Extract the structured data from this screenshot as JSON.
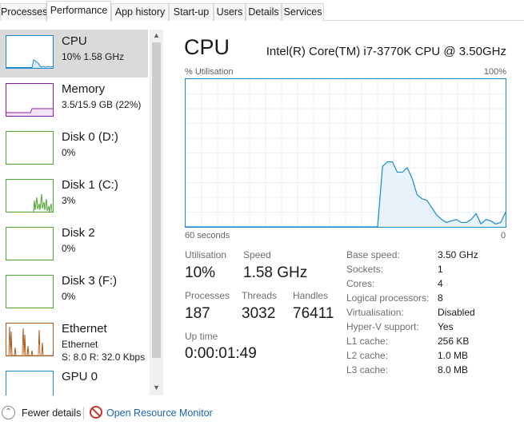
{
  "tabs": [
    "Processes",
    "Performance",
    "App history",
    "Start-up",
    "Users",
    "Details",
    "Services"
  ],
  "sidebar": {
    "items": [
      {
        "name": "CPU",
        "sub": "10% 1.58 GHz",
        "color": "#1a8ad0"
      },
      {
        "name": "Memory",
        "sub": "3.5/15.9 GB (22%)",
        "color": "#8b1ea6"
      },
      {
        "name": "Disk 0 (D:)",
        "sub": "0%",
        "color": "#4da62e"
      },
      {
        "name": "Disk 1 (C:)",
        "sub": "3%",
        "color": "#4da62e"
      },
      {
        "name": "Disk 2",
        "sub": "0%",
        "color": "#4da62e"
      },
      {
        "name": "Disk 3 (F:)",
        "sub": "0%",
        "color": "#4da62e"
      },
      {
        "name": "Ethernet",
        "sub": "Ethernet",
        "sub2": "S: 8.0  R: 32.0 Kbps",
        "color": "#a7551b"
      },
      {
        "name": "GPU 0",
        "color": "#1a8ad0"
      }
    ]
  },
  "main": {
    "title": "CPU",
    "model": "Intel(R) Core(TM) i7-3770K CPU @ 3.50GHz",
    "graph": {
      "ylabel": "% Utilisation",
      "ymax_label": "100%",
      "xlabel": "60 seconds",
      "xend_label": "0",
      "utilisation_percent": [
        0,
        0,
        0,
        0,
        0,
        0,
        0,
        0,
        0,
        0,
        0,
        0,
        0,
        0,
        0,
        0,
        0,
        0,
        0,
        0,
        0,
        0,
        0,
        0,
        0,
        0,
        0,
        0,
        0,
        0,
        0,
        0,
        0,
        0,
        0,
        0,
        0,
        0,
        0,
        0,
        41,
        44,
        44,
        37,
        37,
        40,
        33,
        22,
        19,
        18,
        13,
        8,
        5,
        3,
        4,
        5,
        3,
        3,
        5,
        9,
        2,
        5,
        4,
        2,
        3,
        10
      ]
    },
    "stats": {
      "utilisation_label": "Utilisation",
      "utilisation_value": "10%",
      "speed_label": "Speed",
      "speed_value": "1.58 GHz",
      "processes_label": "Processes",
      "processes_value": "187",
      "threads_label": "Threads",
      "threads_value": "3032",
      "handles_label": "Handles",
      "handles_value": "76411",
      "uptime_label": "Up time",
      "uptime_value": "0:00:01:49"
    },
    "specs": [
      {
        "label": "Base speed:",
        "value": "3.50 GHz"
      },
      {
        "label": "Sockets:",
        "value": "1"
      },
      {
        "label": "Cores:",
        "value": "4"
      },
      {
        "label": "Logical processors:",
        "value": "8"
      },
      {
        "label": "Virtualisation:",
        "value": "Disabled"
      },
      {
        "label": "Hyper-V support:",
        "value": "Yes"
      },
      {
        "label": "L1 cache:",
        "value": "256 KB"
      },
      {
        "label": "L2 cache:",
        "value": "1.0 MB"
      },
      {
        "label": "L3 cache:",
        "value": "8.0 MB"
      }
    ]
  },
  "footer": {
    "fewer_details": "Fewer details",
    "open_resource_monitor": "Open Resource Monitor"
  }
}
